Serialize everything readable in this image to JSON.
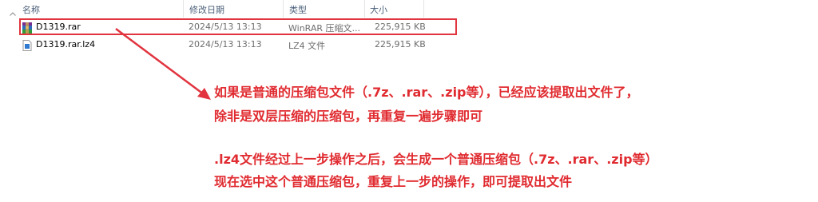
{
  "header": {
    "columns": [
      "名称",
      "修改日期",
      "类型",
      "大小"
    ]
  },
  "files": [
    {
      "name": "D1319.rar",
      "date": "2024/5/13 13:13",
      "type": "WinRAR 压缩文...",
      "size": "225,915 KB",
      "icon": "winrar-archive-icon"
    },
    {
      "name": "D1319.rar.lz4",
      "date": "2024/5/13 13:13",
      "type": "LZ4 文件",
      "size": "225,915 KB",
      "icon": "lz4-file-icon"
    }
  ],
  "annotation": {
    "line1": "如果是普通的压缩包文件（.7z、.rar、.zip等），已经应该提取出文件了，",
    "line2": "除非是双层压缩的压缩包，再重复一遍步骤即可",
    "line3": ".lz4文件经过上一步操作之后，会生成一个普通压缩包（.7z、.rar、.zip等）",
    "line4": "现在选中这个普通压缩包，重复上一步的操作，即可提取出文件"
  },
  "colors": {
    "annotation_red": "#e02b30",
    "highlight_border": "#e1343f",
    "header_text": "#4c607a"
  }
}
